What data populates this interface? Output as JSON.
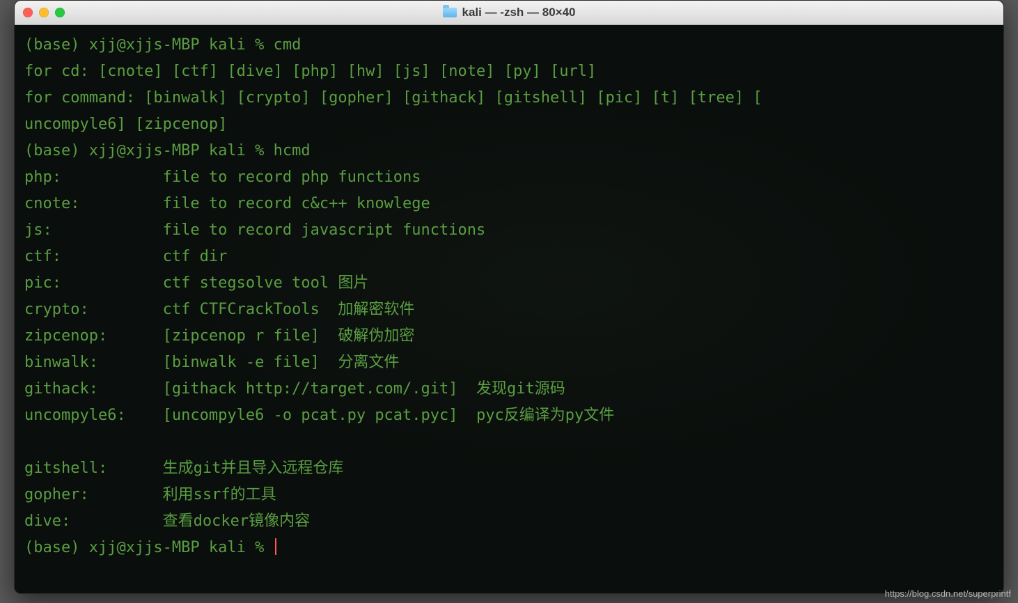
{
  "window": {
    "title": "kali — -zsh — 80×40"
  },
  "prompt": "(base) xjj@xjjs-MBP kali % ",
  "cmd1": "cmd",
  "cmd2": "hcmd",
  "out": {
    "for_cd": "for cd: [cnote] [ctf] [dive] [php] [hw] [js] [note] [py] [url]",
    "for_cmd_l1": "for command: [binwalk] [crypto] [gopher] [githack] [gitshell] [pic] [t] [tree] [",
    "for_cmd_l2": "uncompyle6] [zipcenop]",
    "help": [
      "php:           file to record php functions",
      "cnote:         file to record c&c++ knowlege",
      "js:            file to record javascript functions",
      "ctf:           ctf dir",
      "pic:           ctf stegsolve tool 图片",
      "crypto:        ctf CTFCrackTools  加解密软件",
      "zipcenop:      [zipcenop r file]  破解伪加密",
      "binwalk:       [binwalk -e file]  分离文件",
      "githack:       [githack http://target.com/.git]  发现git源码",
      "uncompyle6:    [uncompyle6 -o pcat.py pcat.pyc]  pyc反编译为py文件",
      "",
      "gitshell:      生成git并且导入远程仓库",
      "gopher:        利用ssrf的工具",
      "dive:          查看docker镜像内容"
    ]
  },
  "watermark": "https://blog.csdn.net/superprintf"
}
